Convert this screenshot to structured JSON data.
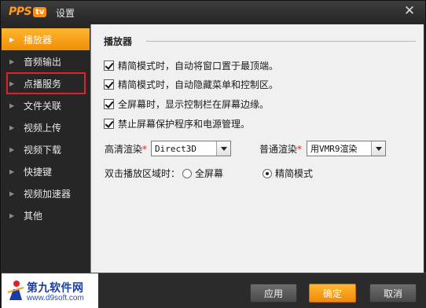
{
  "window": {
    "logo_text": "PPS",
    "logo_badge": "tv",
    "title": "设置",
    "close_glyph": "✕"
  },
  "sidebar": {
    "items": [
      {
        "label": "播放器",
        "active": true
      },
      {
        "label": "音频输出"
      },
      {
        "label": "点播服务",
        "highlighted": true
      },
      {
        "label": "文件关联"
      },
      {
        "label": "视频上传"
      },
      {
        "label": "视频下载"
      },
      {
        "label": "快捷键"
      },
      {
        "label": "视频加速器"
      },
      {
        "label": "其他"
      }
    ]
  },
  "main": {
    "section_title": "播放器",
    "checkboxes": [
      {
        "label": "精简模式时，自动将窗口置于最顶端。",
        "checked": true
      },
      {
        "label": "精简模式时，自动隐藏菜单和控制区。",
        "checked": true
      },
      {
        "label": "全屏幕时，显示控制栏在屏幕边缘。",
        "checked": true
      },
      {
        "label": "禁止屏幕保护程序和电源管理。",
        "checked": true
      }
    ],
    "hd_render": {
      "label": "高清渲染",
      "required_mark": "*",
      "value": "Direct3D"
    },
    "normal_render": {
      "label": "普通渲染",
      "required_mark": "*",
      "value": "用VMR9渲染"
    },
    "double_click": {
      "label": "双击播放区域时：",
      "options": [
        {
          "label": "全屏幕",
          "selected": false
        },
        {
          "label": "精简模式",
          "selected": true
        }
      ]
    }
  },
  "footer": {
    "brand_name": "第九软件网",
    "brand_url": "www.d9soft.com",
    "apply_label": "应用",
    "ok_label": "确定",
    "cancel_label": "取消"
  },
  "colors": {
    "accent": "#f5a01a",
    "highlight_border": "#e0212b"
  }
}
